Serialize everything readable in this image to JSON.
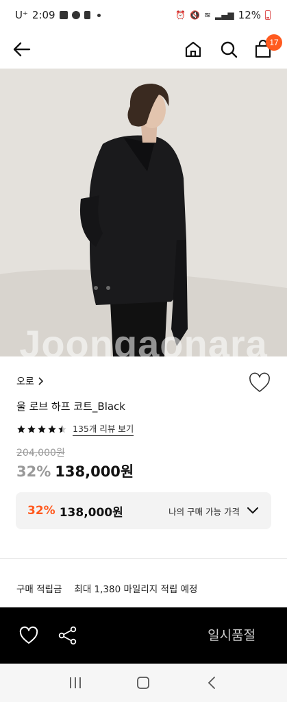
{
  "status_bar": {
    "carrier": "U⁺",
    "time": "2:09",
    "battery": "12%"
  },
  "nav": {
    "cart_count": "17"
  },
  "product": {
    "watermark": "Joongaonara",
    "brand": "오로",
    "name": "울 로브 하프 코트_Black",
    "rating": 4.5,
    "review_link": "135개 리뷰 보기",
    "original_price": "204,000원",
    "discount": "32%",
    "price": "138,000원"
  },
  "my_price": {
    "discount": "32%",
    "price": "138,000원",
    "label": "나의 구매 가능 가격"
  },
  "points": {
    "label": "구매 적립금",
    "value": "최대 1,380 마일리지 적립 예정"
  },
  "bottom_bar": {
    "status_label": "일시품절"
  },
  "colors": {
    "accent": "#ff5a1f",
    "bottom_bar": "#000000"
  }
}
